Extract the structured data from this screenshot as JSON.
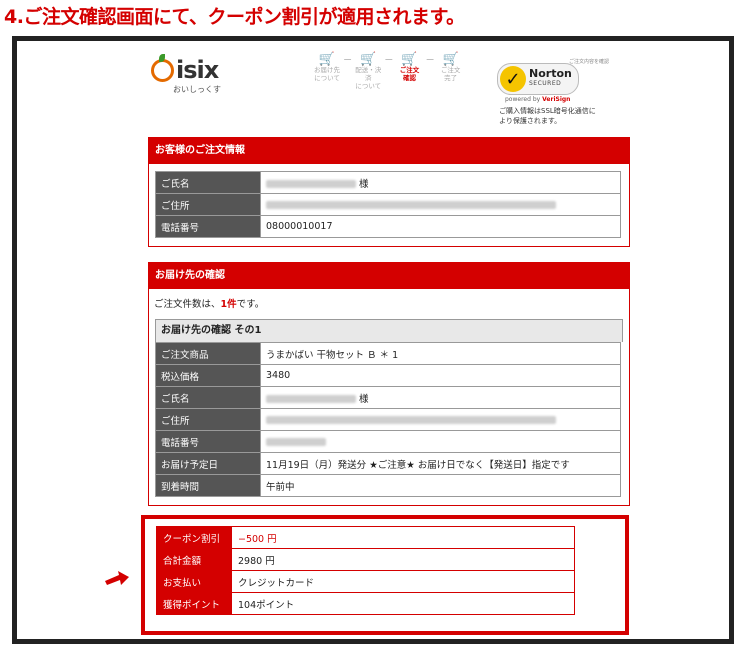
{
  "heading": "4.ご注文確認画面にて、クーポン割引が適用されます。",
  "logo": {
    "name": "isix",
    "tagline": "おいしっくす"
  },
  "steps": [
    {
      "line1": "お届け先",
      "line2": "について",
      "active": false
    },
    {
      "line1": "配送・決済",
      "line2": "について",
      "active": false
    },
    {
      "line1": "ご注文",
      "line2": "確認",
      "active": true
    },
    {
      "line1": "ご注文",
      "line2": "完了",
      "active": false
    }
  ],
  "norton": {
    "top_label": "ご注文内容を確認",
    "name": "Norton",
    "secured": "SECURED",
    "powered_by": "powered by",
    "verisign": "VeriSign",
    "note": "ご購入情報はSSL暗号化通信により保護されます。"
  },
  "customer": {
    "title": "お客様のご注文情報",
    "rows": [
      {
        "label": "ご氏名",
        "value": "様",
        "blurred": 90
      },
      {
        "label": "ご住所",
        "value": "",
        "blurred": 290
      },
      {
        "label": "電話番号",
        "value": "08000010017",
        "blurred": 0
      }
    ]
  },
  "delivery": {
    "title": "お届け先の確認",
    "count_prefix": "ご注文件数は、",
    "count_value": "1件",
    "count_suffix": "です。",
    "sub_title": "お届け先の確認 その1",
    "rows": [
      {
        "label": "ご注文商品",
        "value": "うまかばい 干物セット Ｂ ＊ 1",
        "blurred": 0
      },
      {
        "label": "税込価格",
        "value": "3480",
        "blurred": 0
      },
      {
        "label": "ご氏名",
        "value": "様",
        "blurred": 90
      },
      {
        "label": "ご住所",
        "value": "",
        "blurred": 290
      },
      {
        "label": "電話番号",
        "value": "",
        "blurred": 60
      },
      {
        "label": "お届け予定日",
        "value": "11月19日（月）発送分 ★ご注意★ お届け日でなく【発送日】指定です",
        "blurred": 0
      },
      {
        "label": "到着時間",
        "value": "午前中",
        "blurred": 0
      }
    ]
  },
  "summary": [
    {
      "label": "クーポン割引",
      "value": "−500 円",
      "red": true
    },
    {
      "label": "合計金額",
      "value": "2980 円",
      "red": false
    },
    {
      "label": "お支払い",
      "value": "クレジットカード",
      "red": false
    },
    {
      "label": "獲得ポイント",
      "value": "104ポイント",
      "red": false
    }
  ],
  "colors": {
    "accent": "#d40000",
    "label_bg": "#555555",
    "frame": "#222222"
  }
}
